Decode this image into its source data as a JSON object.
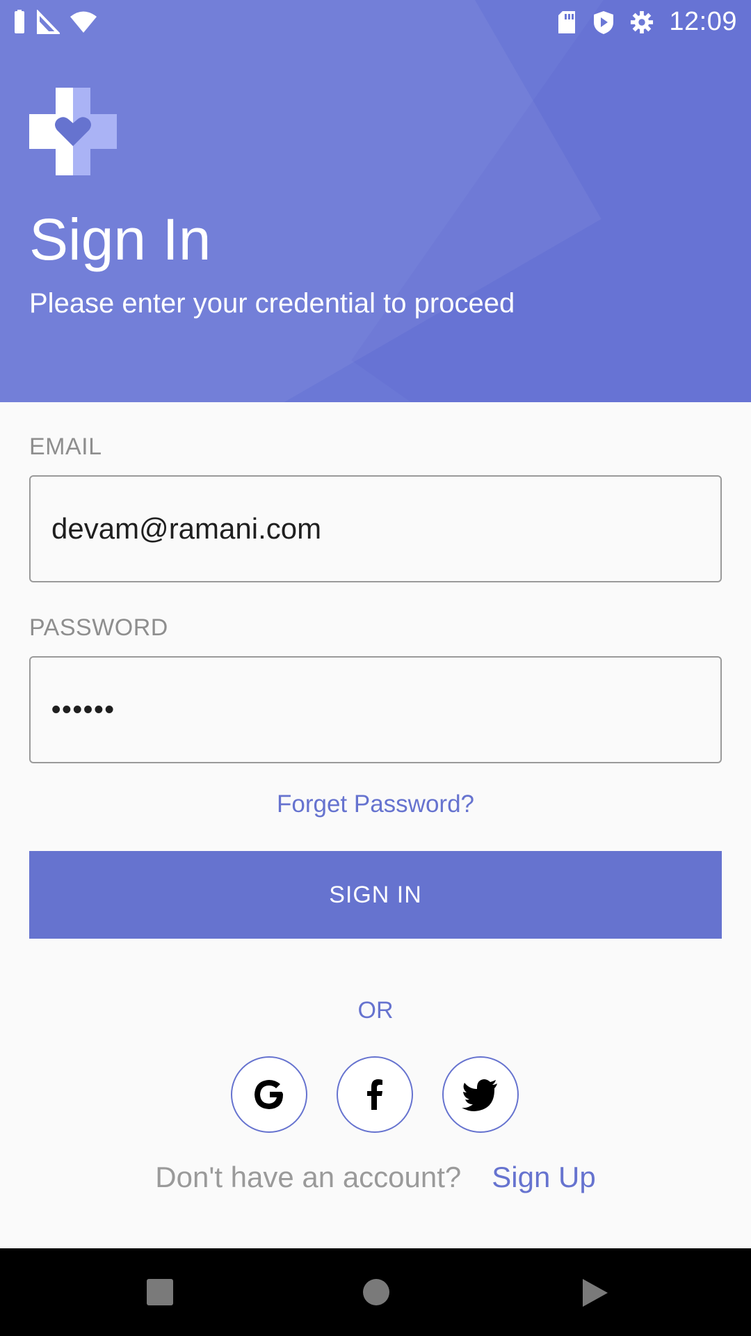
{
  "status_bar": {
    "time": "12:09",
    "left_icons": [
      "battery-icon",
      "signal-icon",
      "wifi-icon"
    ],
    "right_icons": [
      "sd-card-icon",
      "shield-play-icon",
      "settings-gear-icon"
    ]
  },
  "header": {
    "logo_icon": "medical-cross-heart-icon",
    "title": "Sign In",
    "subtitle": "Please enter your credential to proceed"
  },
  "form": {
    "email_label": "EMAIL",
    "email_value": "devam@ramani.com",
    "password_label": "PASSWORD",
    "password_value": "••••••",
    "forgot_label": "Forget Password?",
    "signin_label": "SIGN IN",
    "or_label": "OR"
  },
  "social": {
    "google_icon": "google-icon",
    "facebook_icon": "facebook-icon",
    "twitter_icon": "twitter-icon"
  },
  "footer": {
    "question": "Don't have an account?",
    "signup_label": "Sign Up"
  },
  "nav": {
    "icons": [
      "recents-icon",
      "home-icon",
      "back-icon"
    ]
  },
  "colors": {
    "primary": "#6673cf",
    "header_bg": "#6b78d6",
    "background": "#fafafa"
  }
}
